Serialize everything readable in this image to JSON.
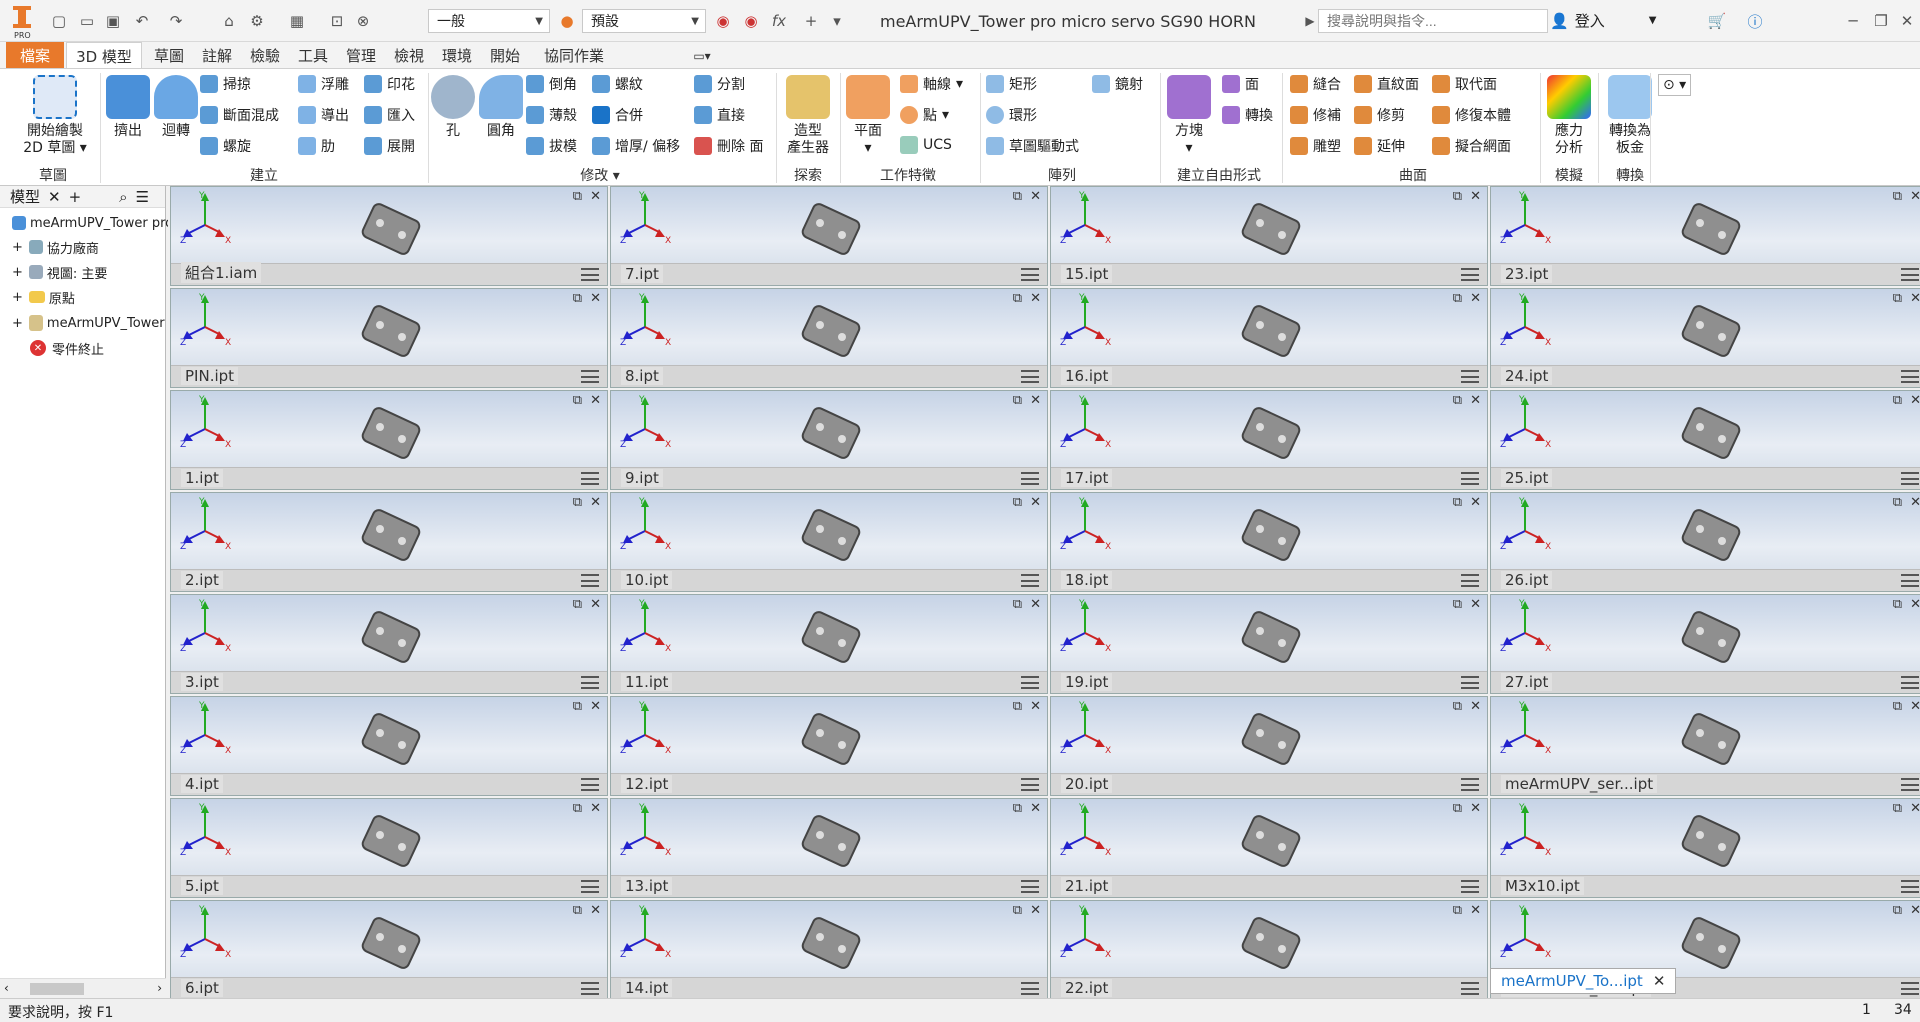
{
  "qat": {
    "style_select": "一般",
    "appearance_select": "預設"
  },
  "title": "meArmUPV_Tower pro micro servo SG90 HORN",
  "search": {
    "placeholder": "搜尋說明與指令..."
  },
  "signin": "登入",
  "tabs": [
    "檔案",
    "3D 模型",
    "草圖",
    "註解",
    "檢驗",
    "工具",
    "管理",
    "檢視",
    "環境",
    "開始",
    "協同作業"
  ],
  "ribbon": {
    "sketch": {
      "start": "開始繪製",
      "start2": "2D 草圖",
      "group": "草圖"
    },
    "create": {
      "extrude": "擠出",
      "revolve": "迴轉",
      "sweep": "掃掠",
      "loft": "斷面混成",
      "coil": "螺旋",
      "emboss": "浮雕",
      "derive": "導出",
      "rib": "肋",
      "imprint": "印花",
      "import": "匯入",
      "unwrap": "展開",
      "group": "建立"
    },
    "modify": {
      "hole": "孔",
      "fillet": "圓角",
      "chamfer": "倒角",
      "shell": "薄殼",
      "draft": "拔模",
      "thread": "螺紋",
      "combine": "合併",
      "thicken": "增厚/ 偏移",
      "split": "分割",
      "direct": "直接",
      "delete_face": "刪除 面",
      "group": "修改"
    },
    "explore": {
      "shape_gen": "造型",
      "shape_gen2": "產生器",
      "group": "探索"
    },
    "work": {
      "plane": "平面",
      "axis": "軸線",
      "point": "點",
      "ucs": "UCS",
      "group": "工作特徵"
    },
    "pattern": {
      "rect": "矩形",
      "circ": "環形",
      "sketch_driven": "草圖驅動式",
      "mirror": "鏡射",
      "group": "陣列"
    },
    "freeform": {
      "box": "方塊",
      "face": "面",
      "convert": "轉換",
      "group": "建立自由形式"
    },
    "surface": {
      "stitch": "縫合",
      "ruled": "直紋面",
      "replace": "取代面",
      "patch": "修補",
      "trim": "修剪",
      "repair": "修復本體",
      "sculpt": "雕塑",
      "extend": "延伸",
      "fit_mesh": "擬合網面",
      "group": "曲面"
    },
    "simulation": {
      "stress": "應力",
      "stress2": "分析",
      "group": "模擬"
    },
    "convert": {
      "sheet": "轉換為",
      "sheet2": "板金",
      "group": "轉換"
    }
  },
  "browser": {
    "tab": "模型",
    "items": [
      "meArmUPV_Tower pro",
      "協力廠商",
      "視圖: 主要",
      "原點",
      "meArmUPV_Tower",
      "零件終止"
    ]
  },
  "windows": [
    [
      "組合1.iam",
      "7.ipt",
      "15.ipt",
      "23.ipt"
    ],
    [
      "PIN.ipt",
      "8.ipt",
      "16.ipt",
      "24.ipt"
    ],
    [
      "1.ipt",
      "9.ipt",
      "17.ipt",
      "25.ipt"
    ],
    [
      "2.ipt",
      "10.ipt",
      "18.ipt",
      "26.ipt"
    ],
    [
      "3.ipt",
      "11.ipt",
      "19.ipt",
      "27.ipt"
    ],
    [
      "4.ipt",
      "12.ipt",
      "20.ipt",
      "meArmUPV_ser...ipt"
    ],
    [
      "5.ipt",
      "13.ipt",
      "21.ipt",
      "M3x10.ipt"
    ],
    [
      "6.ipt",
      "14.ipt",
      "22.ipt",
      "meArmUPV_To...ipt"
    ]
  ],
  "status": {
    "text": "要求說明，按 F1",
    "a": "1",
    "b": "34"
  }
}
